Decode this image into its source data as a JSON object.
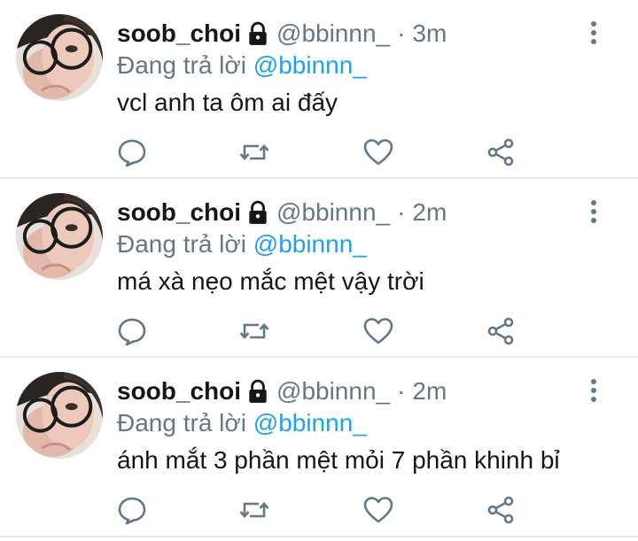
{
  "tweets": [
    {
      "display_name": "soob_choi",
      "handle": "@bbinnn_",
      "separator": "·",
      "time": "3m",
      "replying_prefix": "Đang trả lời",
      "replying_to": "@bbinnn_",
      "text": "vcl anh ta ôm ai đấy",
      "icons": [
        "lock-icon",
        "more-vertical-icon",
        "reply-icon",
        "retweet-icon",
        "like-icon",
        "share-icon"
      ]
    },
    {
      "display_name": "soob_choi",
      "handle": "@bbinnn_",
      "separator": "·",
      "time": "2m",
      "replying_prefix": "Đang trả lời",
      "replying_to": "@bbinnn_",
      "text": "má xà nẹo mắc mệt vậy trời",
      "icons": [
        "lock-icon",
        "more-vertical-icon",
        "reply-icon",
        "retweet-icon",
        "like-icon",
        "share-icon"
      ]
    },
    {
      "display_name": "soob_choi",
      "handle": "@bbinnn_",
      "separator": "·",
      "time": "2m",
      "replying_prefix": "Đang trả lời",
      "replying_to": "@bbinnn_",
      "text": "ánh mắt 3 phần mệt mỏi 7 phần khinh bỉ",
      "icons": [
        "lock-icon",
        "more-vertical-icon",
        "reply-icon",
        "retweet-icon",
        "like-icon",
        "share-icon"
      ]
    }
  ],
  "colors": {
    "name": "#14171a",
    "secondary": "#657786",
    "mention": "#1da1f2",
    "icon": "#657786",
    "divider": "#e6ecf0"
  }
}
